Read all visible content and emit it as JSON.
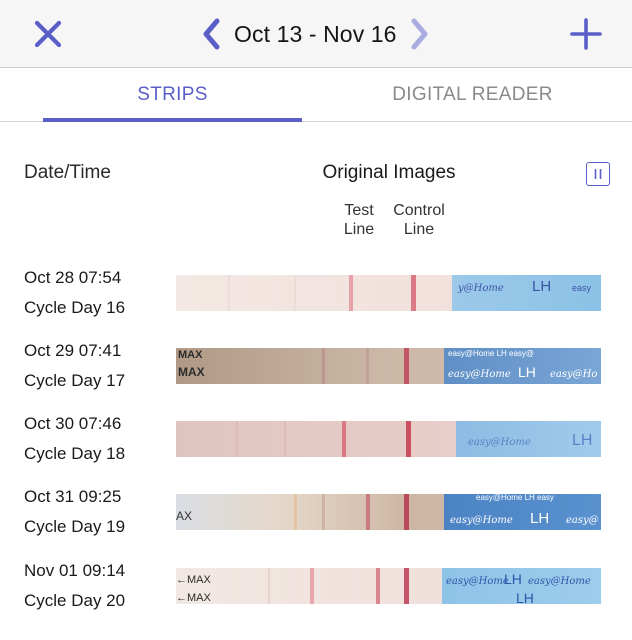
{
  "header": {
    "date_range": "Oct 13 - Nov 16",
    "close_icon": "close-icon",
    "add_icon": "plus-icon",
    "prev_icon": "chevron-left-icon",
    "next_icon": "chevron-right-icon"
  },
  "tabs": [
    {
      "label": "STRIPS",
      "active": true
    },
    {
      "label": "DIGITAL READER",
      "active": false
    }
  ],
  "table": {
    "date_header": "Date/Time",
    "images_header": "Original Images",
    "test_line_label": "Test\nLine",
    "control_line_label": "Control\nLine",
    "pause_icon": "pause-icon"
  },
  "rows": [
    {
      "date": "Oct 28 07:54",
      "cycle": "Cycle Day 16"
    },
    {
      "date": "Oct 29 07:41",
      "cycle": "Cycle Day 17",
      "strip_text": [
        "MAX",
        "MAX"
      ],
      "brand_text": [
        "easy@Home",
        "LH",
        "easy@Ho"
      ]
    },
    {
      "date": "Oct 30 07:46",
      "cycle": "Cycle Day 18",
      "brand_text": [
        "easy@Home",
        "LH"
      ]
    },
    {
      "date": "Oct 31 09:25",
      "cycle": "Cycle Day 19",
      "strip_text": [
        "AX"
      ],
      "brand_text": [
        "easy@Home",
        "LH",
        "easy@"
      ]
    },
    {
      "date": "Nov 01 09:14",
      "cycle": "Cycle Day 20",
      "strip_text": [
        "←MAX",
        "←MAX"
      ],
      "brand_text": [
        "easy@Home",
        "LH",
        "easy@Home",
        "LH"
      ]
    }
  ],
  "colors": {
    "accent": "#5a5fc8",
    "test_line": "#d9737f",
    "control_line": "#c95060",
    "strip_blue": "#8ec5e6"
  }
}
